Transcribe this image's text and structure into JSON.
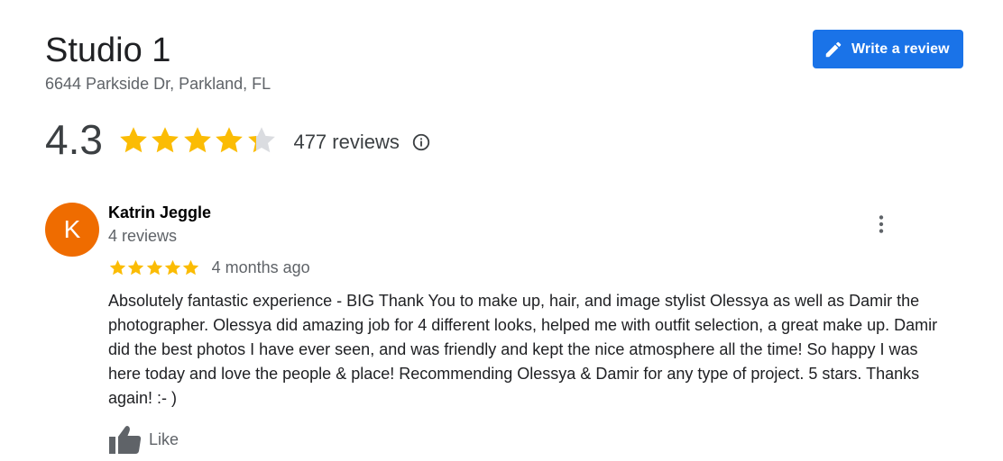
{
  "place": {
    "name": "Studio 1",
    "address": "6644 Parkside Dr, Parkland, FL"
  },
  "actions": {
    "write_review_label": "Write a review",
    "write_review_icon": "pencil-icon"
  },
  "summary": {
    "rating": 4.3,
    "rating_text": "4.3",
    "reviews_text": "477 reviews",
    "star_color": "#fbbc04",
    "info_icon": "info-icon"
  },
  "review": {
    "avatar_letter": "K",
    "avatar_color": "#ef6c00",
    "author": "Katrin Jeggle",
    "author_reviews": "4 reviews",
    "rating": 5,
    "date": "4 months ago",
    "text": "Absolutely fantastic experience - BIG Thank You to make up, hair, and image stylist Olessya as well as Damir the photographer. Olessya did amazing job for 4 different looks, helped me with outfit selection, a great make up. Damir did the best photos I have ever seen, and was friendly and kept the nice atmosphere all the time! So happy I was here today and love the people & place! Recommending Olessya & Damir for any type of project. 5 stars. Thanks again! :- )",
    "like_label": "Like",
    "like_icon": "thumbs-up-icon",
    "more_icon": "more-vert-icon"
  },
  "colors": {
    "accent": "#1a73e8",
    "text_primary": "#202124",
    "text_secondary": "#5f6368",
    "star_empty": "#dadce0"
  }
}
